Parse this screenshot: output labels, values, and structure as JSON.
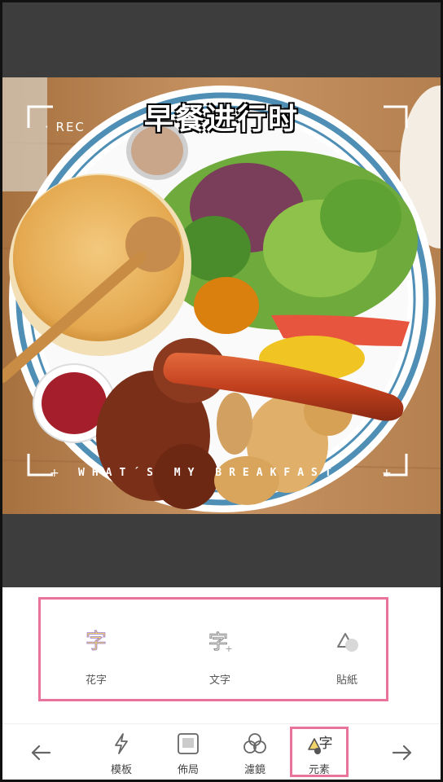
{
  "photo": {
    "title": "早餐进行时",
    "rec": "· REC",
    "caption": "WHAT´S MY BREAKFAST",
    "plus_left": "+",
    "plus_right": "+"
  },
  "tools": [
    {
      "label": "花字",
      "icon": "fancy-text-icon"
    },
    {
      "label": "文字",
      "icon": "text-icon"
    },
    {
      "label": "貼紙",
      "icon": "sticker-icon"
    }
  ],
  "nav": {
    "back_icon": "arrow-left-icon",
    "next_icon": "arrow-right-icon",
    "items": [
      {
        "label": "模板",
        "icon": "lightning-icon"
      },
      {
        "label": "佈局",
        "icon": "layout-icon"
      },
      {
        "label": "濾鏡",
        "icon": "filter-icon"
      },
      {
        "label": "元素",
        "icon": "element-icon",
        "active": true
      }
    ]
  },
  "colors": {
    "highlight": "#e9739c",
    "dark_bar": "#3d3d3d"
  }
}
